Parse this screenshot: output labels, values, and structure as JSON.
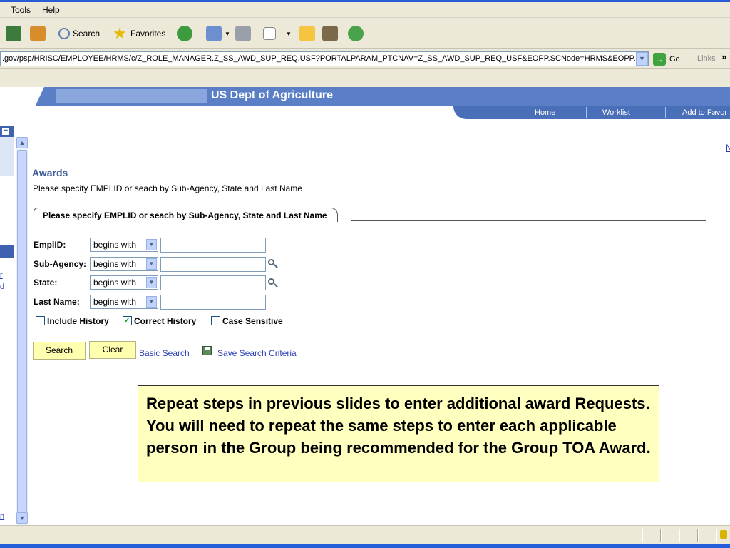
{
  "menu": {
    "tools": "Tools",
    "help": "Help"
  },
  "toolbar": {
    "search_label": "Search",
    "favorites_label": "Favorites"
  },
  "address": {
    "url": ".gov/psp/HRISC/EMPLOYEE/HRMS/c/Z_ROLE_MANAGER.Z_SS_AWD_SUP_REQ.USF?PORTALPARAM_PTCNAV=Z_SS_AWD_SUP_REQ_USF&EOPP.SCNode=HRMS&EOPP.SCF",
    "go_label": "Go",
    "links_label": "Links",
    "more_glyph": "»"
  },
  "header": {
    "org_name": "US Dept of Agriculture",
    "nav": {
      "home": "Home",
      "worklist": "Worklist",
      "add_to_favorites": "Add to Favor"
    }
  },
  "left_nav": {
    "frag1": "r",
    "frag2": "d",
    "frag3": "n"
  },
  "right_frag": "N",
  "page": {
    "title": "Awards",
    "instructions": "Please specify EMPLID or seach by Sub-Agency, State and Last Name",
    "group_box_title": "Please specify EMPLID or seach by Sub-Agency, State and Last Name",
    "fields": [
      {
        "label": "EmplID:",
        "operator": "begins with",
        "value": ""
      },
      {
        "label": "Sub-Agency:",
        "operator": "begins with",
        "value": ""
      },
      {
        "label": "State:",
        "operator": "begins with",
        "value": ""
      },
      {
        "label": "Last Name:",
        "operator": "begins with",
        "value": ""
      }
    ],
    "checkboxes": [
      {
        "label": "Include History",
        "checked": false
      },
      {
        "label": "Correct History",
        "checked": true
      },
      {
        "label": "Case Sensitive",
        "checked": false
      }
    ],
    "buttons": {
      "search": "Search",
      "clear": "Clear"
    },
    "links": {
      "basic_search": "Basic Search",
      "save_search": "Save Search Criteria"
    }
  },
  "callout_text": "Repeat steps in previous slides to enter additional award Requests.  You will need to repeat the same steps to enter each applicable person in the Group being recommended for the Group TOA Award.",
  "icons": {
    "refresh": "refresh-icon",
    "home": "home-icon",
    "search": "search-icon",
    "favorites": "star-icon",
    "history": "history-icon",
    "mail": "mail-icon",
    "print": "print-icon",
    "edit": "word-icon",
    "folder": "folder-icon",
    "research": "research-icon",
    "messenger": "messenger-icon"
  },
  "colors": {
    "banner": "#5b7fc7",
    "nav_banner": "#4a6fb9",
    "title": "#3d5b9a",
    "link": "#2a3fb7",
    "callout_bg": "#ffffc0",
    "button_bg": "#ffffb0"
  }
}
